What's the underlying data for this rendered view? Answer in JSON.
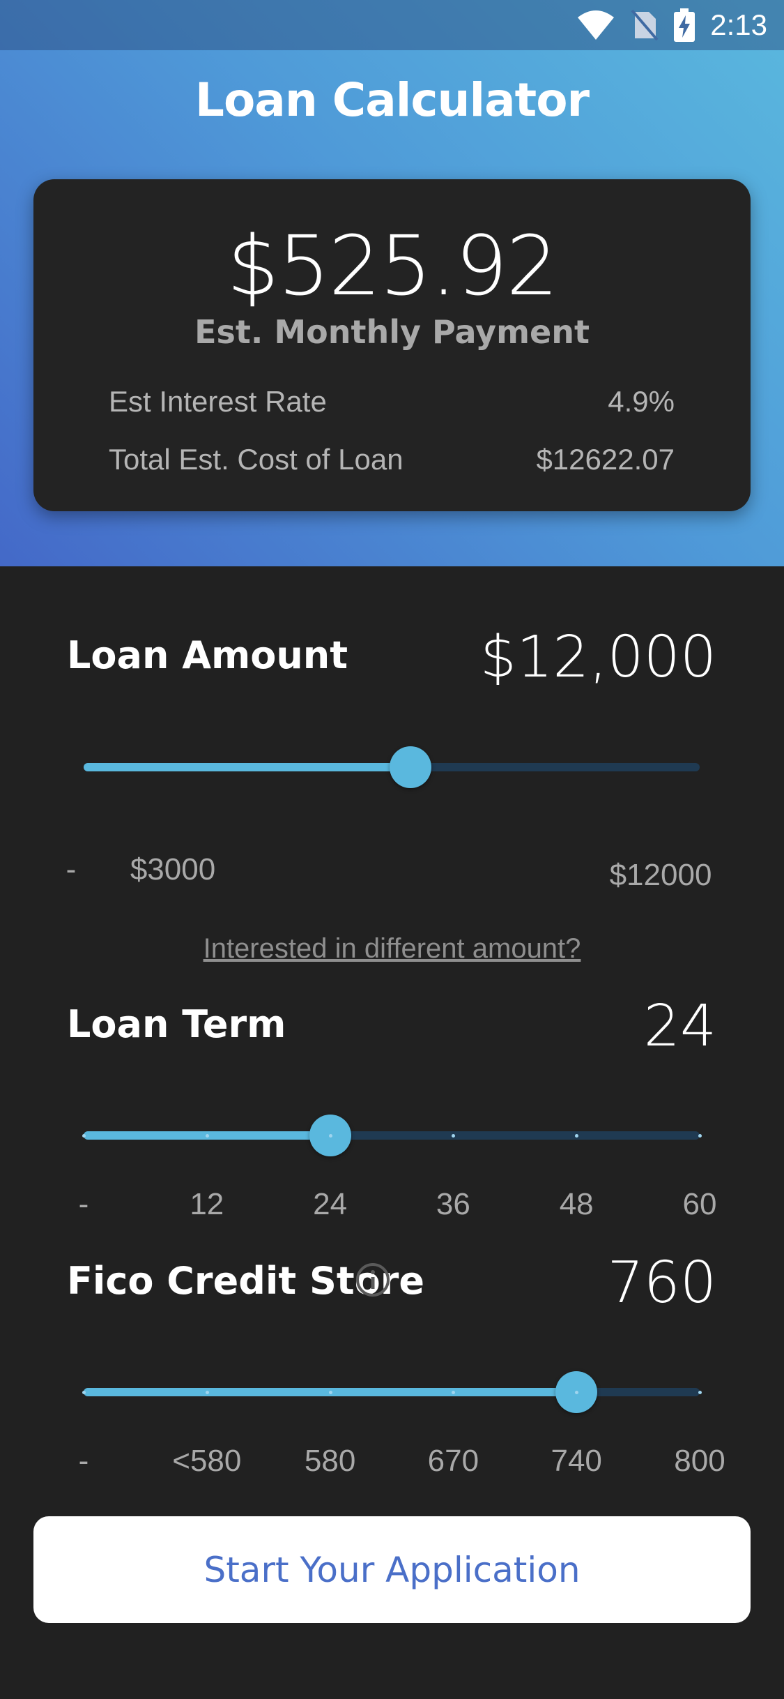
{
  "status_bar": {
    "time": "2:13",
    "icons": [
      "wifi-icon",
      "no-sim-icon",
      "battery-charging-icon"
    ]
  },
  "header": {
    "title": "Loan Calculator"
  },
  "summary": {
    "monthly_payment": "$525.92",
    "monthly_payment_label": "Est. Monthly Payment",
    "interest_rate_label": "Est Interest Rate",
    "interest_rate_value": "4.9%",
    "total_cost_label": "Total Est. Cost of Loan",
    "total_cost_value": "$12622.07"
  },
  "loan_amount": {
    "label": "Loan Amount",
    "value": "$12,000",
    "slider_fraction": 0.53,
    "range_dash": "-",
    "min_label": "$3000",
    "max_label": "$12000",
    "link_text": "Interested in different amount?"
  },
  "loan_term": {
    "label": "Loan Term",
    "value": "24",
    "slider_fraction": 0.4,
    "ticks": [
      "-",
      "12",
      "24",
      "36",
      "48",
      "60"
    ]
  },
  "credit_score": {
    "label": "Fico Credit Store",
    "value": "760",
    "slider_fraction": 0.8,
    "ticks": [
      "-",
      "<580",
      "580",
      "670",
      "740",
      "800"
    ]
  },
  "cta": {
    "label": "Start Your Application"
  },
  "colors": {
    "accent": "#5ab8de",
    "track": "#1f3a52",
    "background": "#212121",
    "card": "#232323",
    "button_text": "#4a6fc8"
  }
}
